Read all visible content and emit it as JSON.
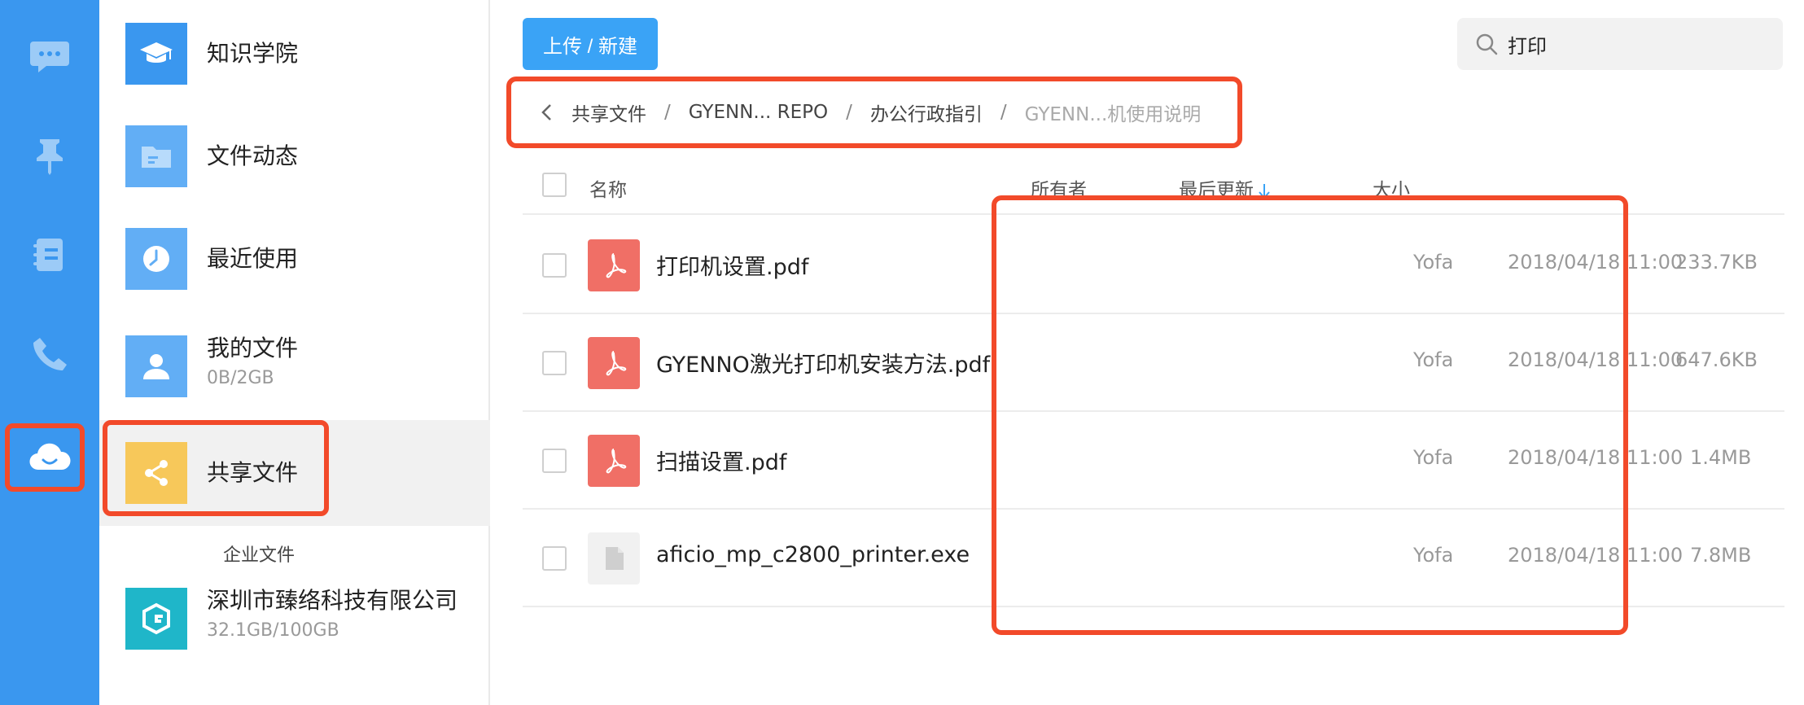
{
  "rail": {
    "items": [
      {
        "icon": "chat-icon"
      },
      {
        "icon": "pin-icon"
      },
      {
        "icon": "contacts-book-icon"
      },
      {
        "icon": "phone-icon"
      },
      {
        "icon": "cloud-drive-icon"
      }
    ]
  },
  "nav": {
    "items": [
      {
        "label": "知识学院",
        "icon": "graduation-cap-icon",
        "color": "#3a97ef"
      },
      {
        "label": "文件动态",
        "icon": "folder-icon",
        "color": "#62aef5"
      },
      {
        "label": "最近使用",
        "icon": "clock-icon",
        "color": "#62aef5"
      },
      {
        "label": "我的文件",
        "sub": "0B/2GB",
        "icon": "user-icon",
        "color": "#62aef5"
      },
      {
        "label": "共享文件",
        "icon": "share-icon",
        "color": "#f7c85a"
      }
    ],
    "section_title": "企业文件",
    "company": {
      "label": "深圳市臻络科技有限公司",
      "sub": "32.1GB/100GB",
      "icon": "company-logo-icon",
      "color": "#1fb6c9"
    }
  },
  "toolbar": {
    "upload_label": "上传 / 新建",
    "search_value": "打印"
  },
  "breadcrumb": {
    "items": [
      "共享文件",
      "GYENN... REPO",
      "办公行政指引"
    ],
    "current": "GYENN...机使用说明",
    "separator": "/"
  },
  "table": {
    "headers": {
      "name": "名称",
      "owner": "所有者",
      "updated": "最后更新",
      "size": "大小"
    },
    "rows": [
      {
        "name": "打印机设置.pdf",
        "type": "pdf-file-icon",
        "owner": "Yofa",
        "updated": "2018/04/18 11:00",
        "size": "233.7KB"
      },
      {
        "name": "GYENNO激光打印机安装方法.pdf",
        "type": "pdf-file-icon",
        "owner": "Yofa",
        "updated": "2018/04/18 11:00",
        "size": "647.6KB"
      },
      {
        "name": "扫描设置.pdf",
        "type": "pdf-file-icon",
        "owner": "Yofa",
        "updated": "2018/04/18 11:00",
        "size": "1.4MB"
      },
      {
        "name": "aficio_mp_c2800_printer.exe",
        "type": "generic-file-icon",
        "owner": "Yofa",
        "updated": "2018/04/18 11:00",
        "size": "7.8MB"
      }
    ]
  },
  "colors": {
    "rail": "#3a97ef",
    "accent": "#3aa3f6",
    "highlight": "#f24a2a",
    "pdf": "#f06f66"
  }
}
